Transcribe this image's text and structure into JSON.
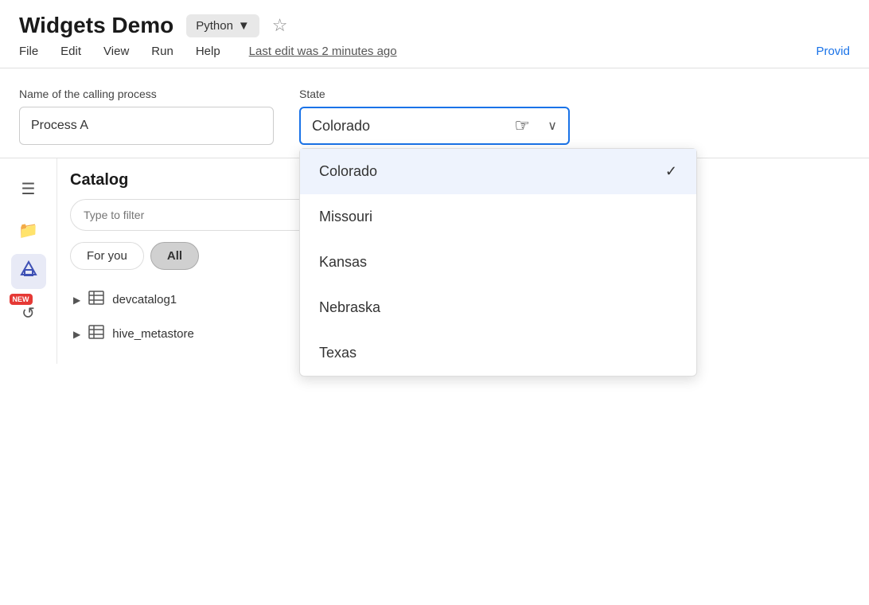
{
  "header": {
    "title": "Widgets Demo",
    "language": "Python",
    "last_edit": "Last edit was 2 minutes ago",
    "provide_link": "Provid"
  },
  "menu": {
    "items": [
      "File",
      "Edit",
      "View",
      "Run",
      "Help"
    ]
  },
  "form": {
    "process_label": "Name of the calling process",
    "process_value": "Process A",
    "state_label": "State",
    "state_selected": "Colorado"
  },
  "dropdown": {
    "options": [
      {
        "label": "Colorado",
        "selected": true
      },
      {
        "label": "Missouri",
        "selected": false
      },
      {
        "label": "Kansas",
        "selected": false
      },
      {
        "label": "Nebraska",
        "selected": false
      },
      {
        "label": "Texas",
        "selected": false
      }
    ]
  },
  "catalog": {
    "title": "Catalog",
    "filter_placeholder": "Type to filter",
    "tabs": [
      {
        "label": "For you",
        "active": false
      },
      {
        "label": "All",
        "active": true
      }
    ],
    "items": [
      {
        "name": "devcatalog1"
      },
      {
        "name": "hive_metastore"
      }
    ]
  },
  "sidebar": {
    "icons": [
      {
        "name": "catalog-icon",
        "symbol": "☰",
        "active": false
      },
      {
        "name": "folder-icon",
        "symbol": "🗂",
        "active": false
      },
      {
        "name": "schema-icon",
        "symbol": "△□",
        "active": true
      },
      {
        "name": "chat-icon",
        "symbol": "↺",
        "active": false,
        "badge": "NEW"
      }
    ]
  }
}
